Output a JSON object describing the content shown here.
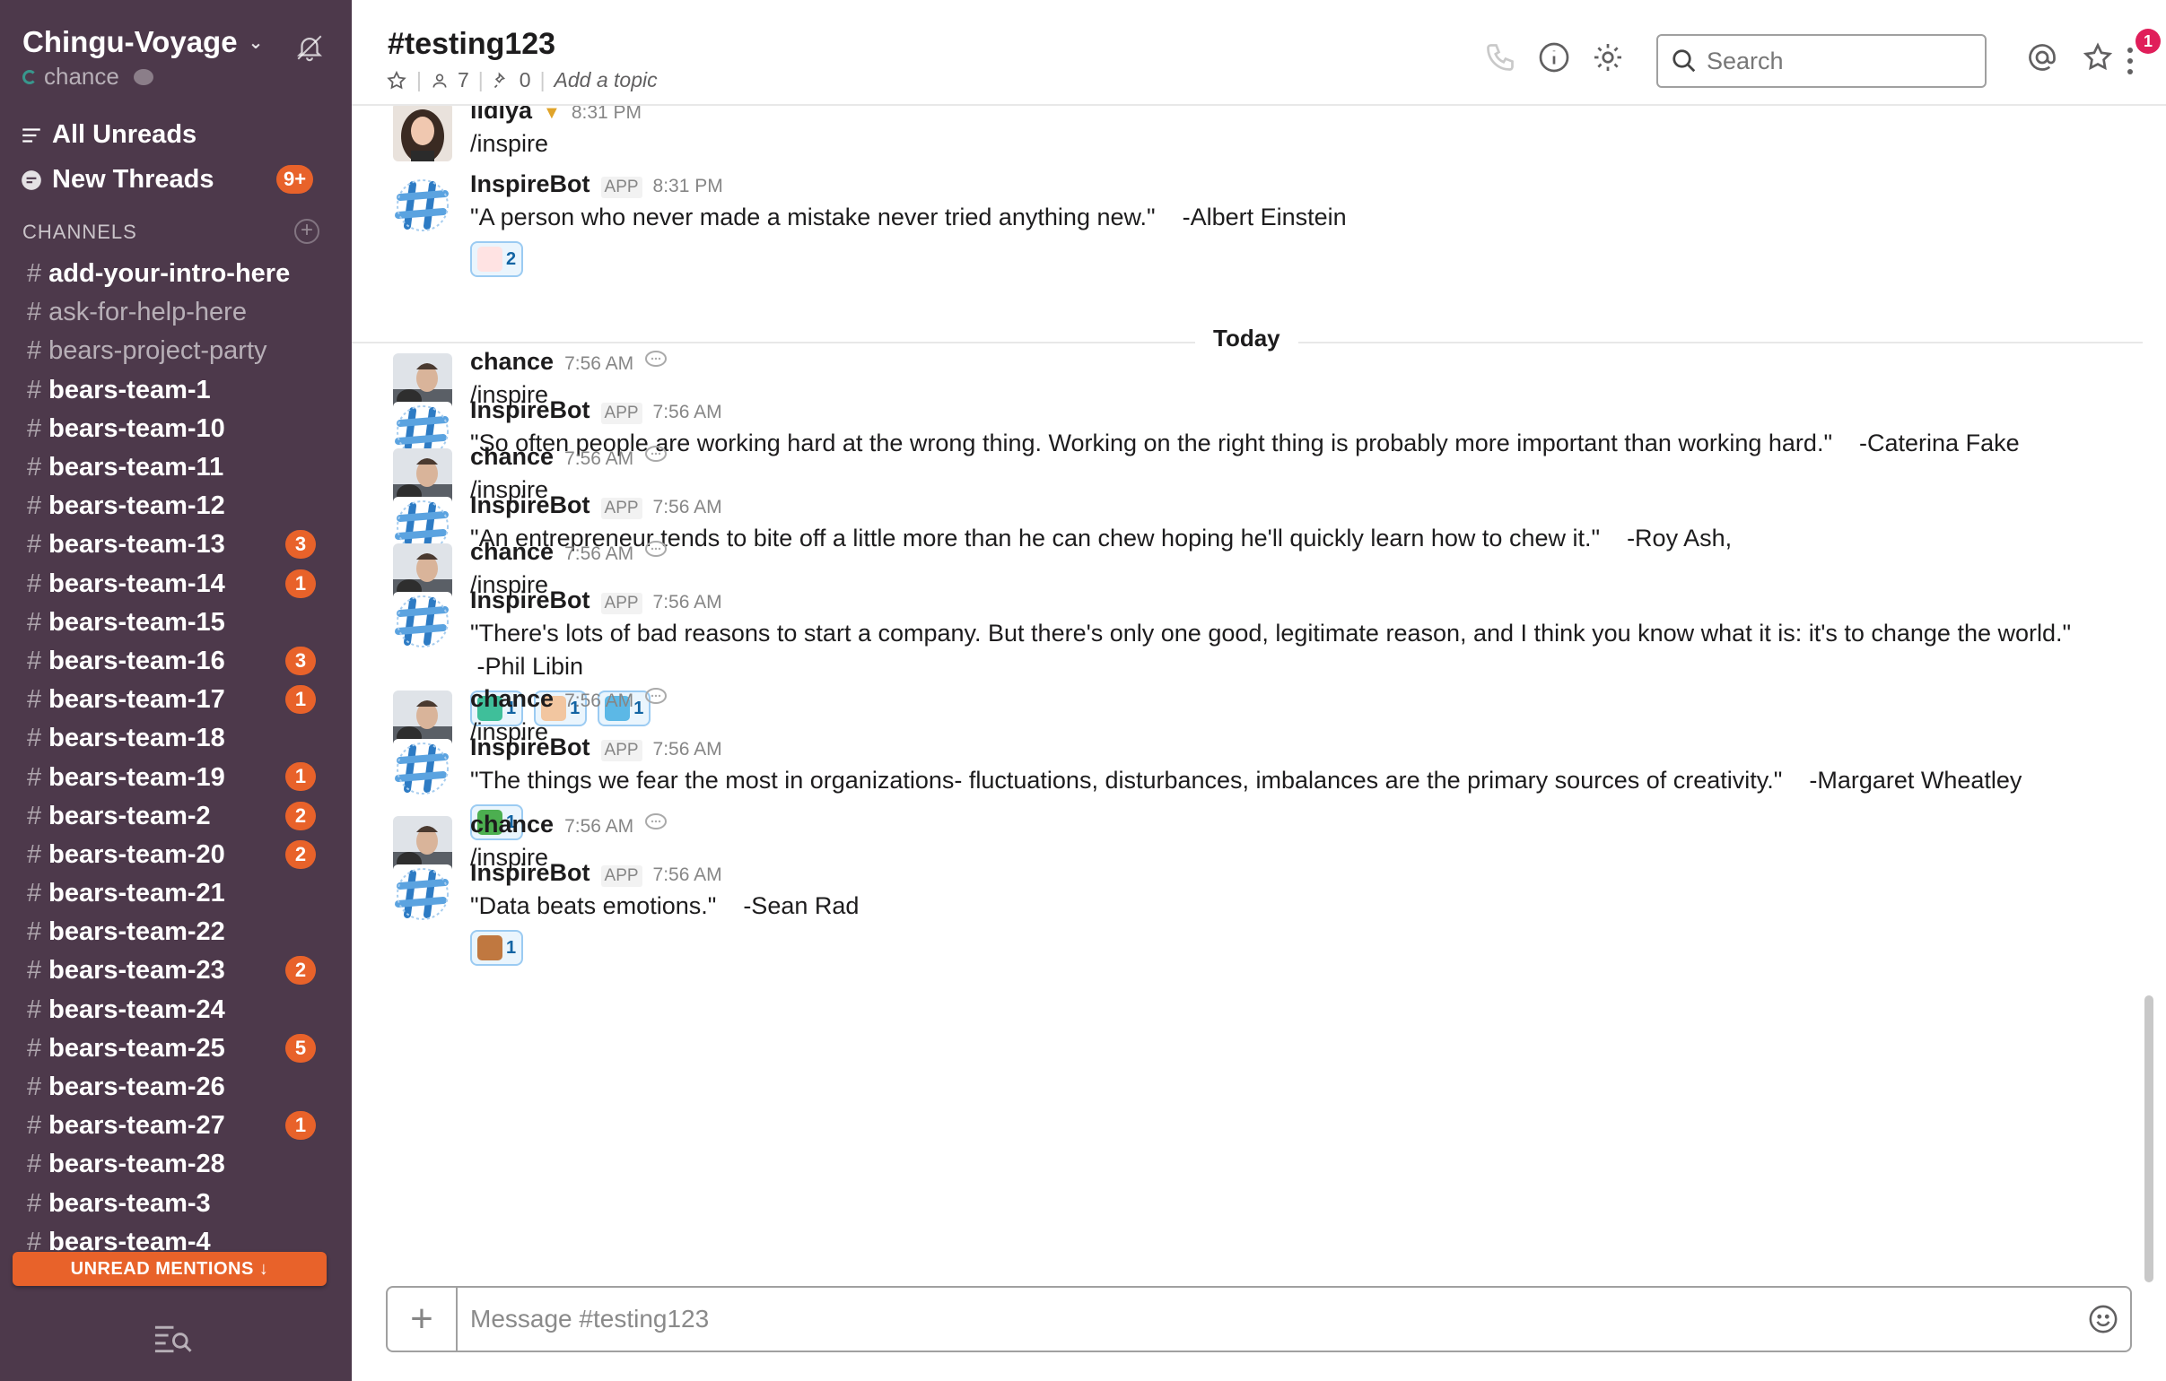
{
  "sidebar": {
    "team_name": "Chingu-Voyage",
    "user_name": "chance",
    "nav": {
      "all_unreads": "All Unreads",
      "new_threads": "New Threads",
      "new_threads_badge": "9+"
    },
    "channels_header": "CHANNELS",
    "channels": [
      {
        "name": "add-your-intro-here",
        "badge": "",
        "bold": true
      },
      {
        "name": "ask-for-help-here",
        "badge": "",
        "bold": false
      },
      {
        "name": "bears-project-party",
        "badge": "",
        "bold": false
      },
      {
        "name": "bears-team-1",
        "badge": "",
        "bold": true
      },
      {
        "name": "bears-team-10",
        "badge": "",
        "bold": true
      },
      {
        "name": "bears-team-11",
        "badge": "",
        "bold": true
      },
      {
        "name": "bears-team-12",
        "badge": "",
        "bold": true
      },
      {
        "name": "bears-team-13",
        "badge": "3",
        "bold": true
      },
      {
        "name": "bears-team-14",
        "badge": "1",
        "bold": true
      },
      {
        "name": "bears-team-15",
        "badge": "",
        "bold": true
      },
      {
        "name": "bears-team-16",
        "badge": "3",
        "bold": true
      },
      {
        "name": "bears-team-17",
        "badge": "1",
        "bold": true
      },
      {
        "name": "bears-team-18",
        "badge": "",
        "bold": true
      },
      {
        "name": "bears-team-19",
        "badge": "1",
        "bold": true
      },
      {
        "name": "bears-team-2",
        "badge": "2",
        "bold": true
      },
      {
        "name": "bears-team-20",
        "badge": "2",
        "bold": true
      },
      {
        "name": "bears-team-21",
        "badge": "",
        "bold": true
      },
      {
        "name": "bears-team-22",
        "badge": "",
        "bold": true
      },
      {
        "name": "bears-team-23",
        "badge": "2",
        "bold": true
      },
      {
        "name": "bears-team-24",
        "badge": "",
        "bold": true
      },
      {
        "name": "bears-team-25",
        "badge": "5",
        "bold": true
      },
      {
        "name": "bears-team-26",
        "badge": "",
        "bold": true
      },
      {
        "name": "bears-team-27",
        "badge": "1",
        "bold": true
      },
      {
        "name": "bears-team-28",
        "badge": "",
        "bold": true
      },
      {
        "name": "bears-team-3",
        "badge": "",
        "bold": true
      },
      {
        "name": "bears-team-4",
        "badge": "",
        "bold": true
      }
    ],
    "unread_mentions": "UNREAD MENTIONS ↓"
  },
  "header": {
    "channel_title": "#testing123",
    "members_count": "7",
    "pinned_count": "0",
    "topic_placeholder": "Add a topic",
    "search_placeholder": "Search",
    "notification_badge": "1"
  },
  "messages": [
    {
      "author": "lidiya",
      "app": "",
      "time": "8:31 PM",
      "text": "/inspire",
      "avatar": "person-female",
      "reactions": []
    },
    {
      "author": "InspireBot",
      "app": "APP",
      "time": "8:31 PM",
      "text": "\"A person who never made a mistake never tried anything new.\"    -Albert Einstein",
      "avatar": "bot",
      "reactions": [
        {
          "emoji": "100-icon",
          "count": "2"
        }
      ]
    },
    {
      "author": "chance",
      "app": "",
      "time": "7:56 AM",
      "text": "/inspire",
      "avatar": "person-male",
      "reactions": []
    },
    {
      "author": "InspireBot",
      "app": "APP",
      "time": "7:56 AM",
      "text": "\"So often people are working hard at the wrong thing. Working on the right thing is probably more important than working hard.\"    -Caterina Fake",
      "avatar": "bot",
      "reactions": []
    },
    {
      "author": "chance",
      "app": "",
      "time": "7:56 AM",
      "text": "/inspire",
      "avatar": "person-male",
      "reactions": []
    },
    {
      "author": "InspireBot",
      "app": "APP",
      "time": "7:56 AM",
      "text": "\"An entrepreneur tends to bite off a little more than he can chew hoping he'll quickly learn how to chew it.\"    -Roy Ash,",
      "avatar": "bot",
      "reactions": []
    },
    {
      "author": "chance",
      "app": "",
      "time": "7:56 AM",
      "text": "/inspire",
      "avatar": "person-male",
      "reactions": []
    },
    {
      "author": "InspireBot",
      "app": "APP",
      "time": "7:56 AM",
      "text": "\"There's lots of bad reasons to start a company. But there's only one good, legitimate reason, and I think you know what it is: it's to change the world.\"\n -Phil Libin",
      "avatar": "bot",
      "reactions": [
        {
          "emoji": "badge-icon",
          "count": "1"
        },
        {
          "emoji": "handshake-icon",
          "count": "1"
        },
        {
          "emoji": "worker-icon",
          "count": "1"
        }
      ]
    },
    {
      "author": "chance",
      "app": "",
      "time": "7:56 AM",
      "text": "/inspire",
      "avatar": "person-male",
      "reactions": []
    },
    {
      "author": "InspireBot",
      "app": "APP",
      "time": "7:56 AM",
      "text": "\"The things we fear the most in organizations- fluctuations, disturbances, imbalances are the primary sources of creativity.\"    -Margaret Wheatley",
      "avatar": "bot",
      "reactions": [
        {
          "emoji": "mushroom-icon",
          "count": "1"
        }
      ]
    },
    {
      "author": "chance",
      "app": "",
      "time": "7:56 AM",
      "text": "/inspire",
      "avatar": "person-male",
      "reactions": []
    },
    {
      "author": "InspireBot",
      "app": "APP",
      "time": "7:56 AM",
      "text": "\"Data beats emotions.\"    -Sean Rad",
      "avatar": "bot",
      "reactions": [
        {
          "emoji": "people-icon",
          "count": "1"
        }
      ]
    }
  ],
  "day_divider": "Today",
  "composer": {
    "placeholder": "Message #testing123"
  },
  "colors": {
    "sidebar_bg": "#4d394b",
    "badge": "#e8622a",
    "reaction_border": "#9bcbf2",
    "notif": "#e01e5a"
  }
}
